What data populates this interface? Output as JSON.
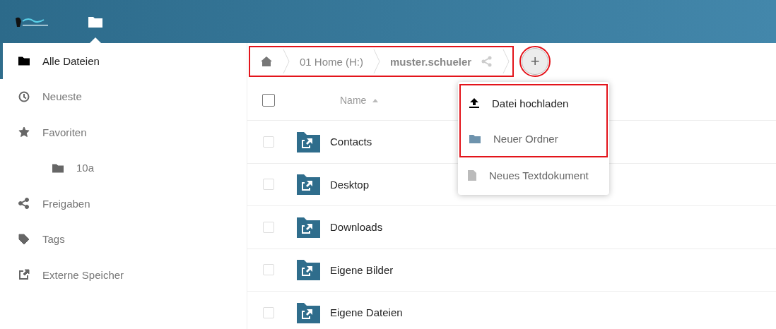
{
  "header": {
    "apps": [
      {
        "kind": "files",
        "selected": true
      }
    ]
  },
  "sidebar": {
    "items": [
      {
        "kind": "folder",
        "label": "Alle Dateien",
        "selected": true
      },
      {
        "kind": "clock",
        "label": "Neueste",
        "selected": false
      },
      {
        "kind": "star",
        "label": "Favoriten",
        "selected": false,
        "children": [
          {
            "kind": "folder",
            "label": "10a",
            "selected": false
          }
        ]
      },
      {
        "kind": "share",
        "label": "Freigaben",
        "selected": false
      },
      {
        "kind": "tag",
        "label": "Tags",
        "selected": false
      },
      {
        "kind": "external",
        "label": "Externe Speicher",
        "selected": false
      }
    ]
  },
  "breadcrumb": {
    "highlighted": true,
    "items": [
      {
        "kind": "home"
      },
      {
        "kind": "text",
        "label": "01 Home (H:)",
        "current": false
      },
      {
        "kind": "text",
        "label": "muster.schueler",
        "current": true
      }
    ]
  },
  "new_button": {
    "label": "+",
    "highlighted": true
  },
  "table": {
    "columns": [
      {
        "label": "Name",
        "sorted": true
      }
    ],
    "all_checked": false,
    "rows": [
      {
        "name": "Contacts",
        "checked": false
      },
      {
        "name": "Desktop",
        "checked": false
      },
      {
        "name": "Downloads",
        "checked": false
      },
      {
        "name": "Eigene Bilder",
        "checked": false
      },
      {
        "name": "Eigene Dateien",
        "checked": false
      }
    ]
  },
  "new_menu": {
    "items": [
      {
        "kind": "upload",
        "label": "Datei hochladen",
        "highlighted": true
      },
      {
        "kind": "folder",
        "label": "Neuer Ordner",
        "highlighted": true
      },
      {
        "kind": "document",
        "label": "Neues Textdokument",
        "highlighted": false
      }
    ]
  }
}
